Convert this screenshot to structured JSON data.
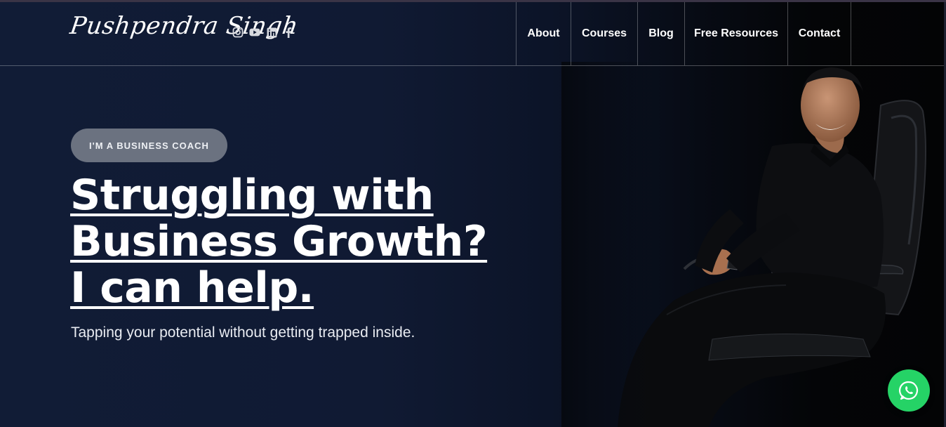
{
  "header": {
    "logo_text": "Pushpendra Singh",
    "social_icons": [
      "instagram-icon",
      "youtube-icon",
      "linkedin-icon",
      "facebook-icon"
    ],
    "nav": [
      {
        "label": "About"
      },
      {
        "label": "Courses"
      },
      {
        "label": "Blog"
      },
      {
        "label": "Free Resources"
      },
      {
        "label": "Contact"
      }
    ]
  },
  "hero": {
    "badge": "I'M A BUSINESS COACH",
    "headline_lines": [
      "Struggling with",
      "Business Growth?",
      "I can help."
    ],
    "tagline": "Tapping your potential without getting trapped inside."
  },
  "floating": {
    "whatsapp_icon": "whatsapp-icon"
  },
  "colors": {
    "background": "#0f1a33",
    "badge_bg": "#6b7280",
    "whatsapp": "#25d366",
    "text": "#ffffff"
  }
}
